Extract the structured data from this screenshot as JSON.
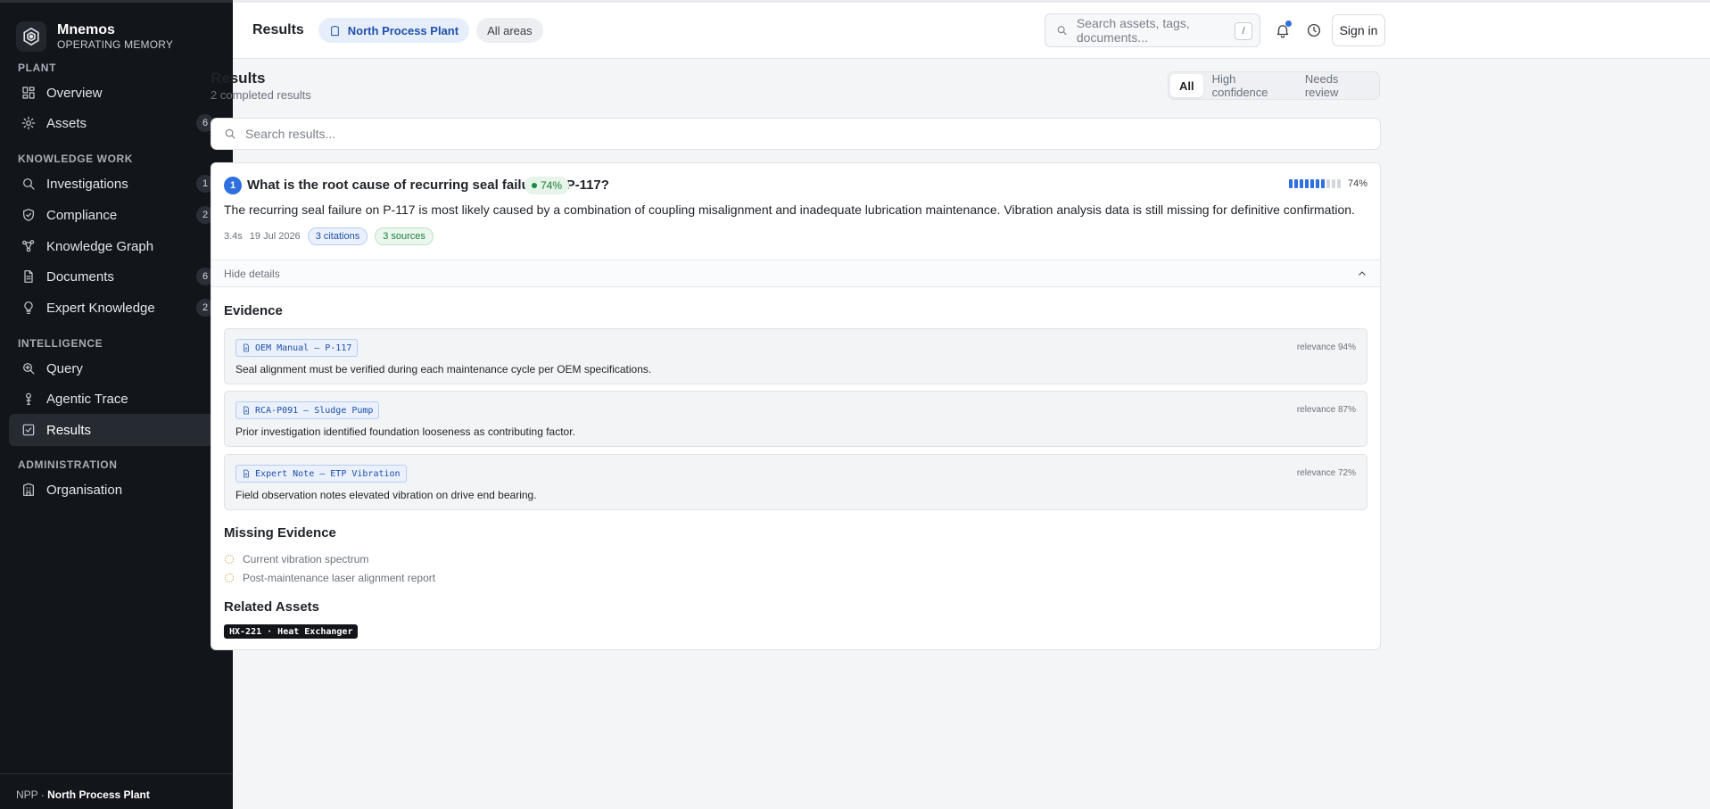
{
  "brand": {
    "name": "Mnemos",
    "subtitle": "OPERATING MEMORY"
  },
  "sidebar": {
    "sections": [
      {
        "label": "PLANT"
      },
      {
        "label": "KNOWLEDGE WORK"
      },
      {
        "label": "INTELLIGENCE"
      },
      {
        "label": "ADMINISTRATION"
      }
    ],
    "items": [
      {
        "label": "Overview",
        "icon": "grid-icon"
      },
      {
        "label": "Assets",
        "icon": "sun-icon",
        "badge": "6"
      },
      {
        "label": "Investigations",
        "icon": "search-icon",
        "badge": "1"
      },
      {
        "label": "Compliance",
        "icon": "shield-check-icon",
        "badge": "2"
      },
      {
        "label": "Knowledge Graph",
        "icon": "graph-icon"
      },
      {
        "label": "Documents",
        "icon": "document-icon",
        "badge": "6"
      },
      {
        "label": "Expert Knowledge",
        "icon": "lightbulb-icon",
        "badge": "2"
      },
      {
        "label": "Query",
        "icon": "zoom-icon"
      },
      {
        "label": "Agentic Trace",
        "icon": "trace-icon"
      },
      {
        "label": "Results",
        "icon": "checkbox-icon",
        "active": true
      },
      {
        "label": "Organisation",
        "icon": "building-icon"
      }
    ],
    "footer": {
      "code": "NPP ·",
      "plant": "North Process Plant"
    }
  },
  "topbar": {
    "title": "Results",
    "plant_chip": "North Process Plant",
    "areas_chip": "All areas",
    "search_placeholder": "Search assets, tags, documents...",
    "search_shortcut": "/",
    "signin": "Sign in"
  },
  "main": {
    "title": "Results",
    "subtitle": "2 completed results",
    "filters": [
      "All",
      "High confidence",
      "Needs review"
    ],
    "active_filter": "All",
    "search_placeholder": "Search results..."
  },
  "result": {
    "number": "1",
    "question": "What is the root cause of recurring seal failure on P-117?",
    "confidence_label": "74%",
    "confidence_value": 0.74,
    "confidence_pct": "74%",
    "answer": "The recurring seal failure on P-117 is most likely caused by a combination of coupling misalignment and inadequate lubrication maintenance. Vibration analysis data is still missing for definitive confirmation.",
    "duration": "3.4s",
    "date": "19 Jul 2026",
    "citations": "3 citations",
    "sources": "3 sources",
    "details_toggle": "Hide details",
    "evidence_title": "Evidence",
    "evidence": [
      {
        "source": "OEM Manual — P-117",
        "relevance": "relevance 94%",
        "text": "Seal alignment must be verified during each maintenance cycle per OEM specifications."
      },
      {
        "source": "RCA-P091 — Sludge Pump",
        "relevance": "relevance 87%",
        "text": "Prior investigation identified foundation looseness as contributing factor."
      },
      {
        "source": "Expert Note — ETP Vibration",
        "relevance": "relevance 72%",
        "text": "Field observation notes elevated vibration on drive end bearing."
      }
    ],
    "missing_title": "Missing Evidence",
    "missing": [
      "Current vibration spectrum",
      "Post-maintenance laser alignment report"
    ],
    "related_title": "Related Assets",
    "related_asset": "HX-221 · Heat Exchanger"
  },
  "colors": {
    "accent": "#2f6fe0",
    "sidebar_bg": "#121519",
    "success": "#1b7f3b",
    "warning": "#c98a1b"
  }
}
